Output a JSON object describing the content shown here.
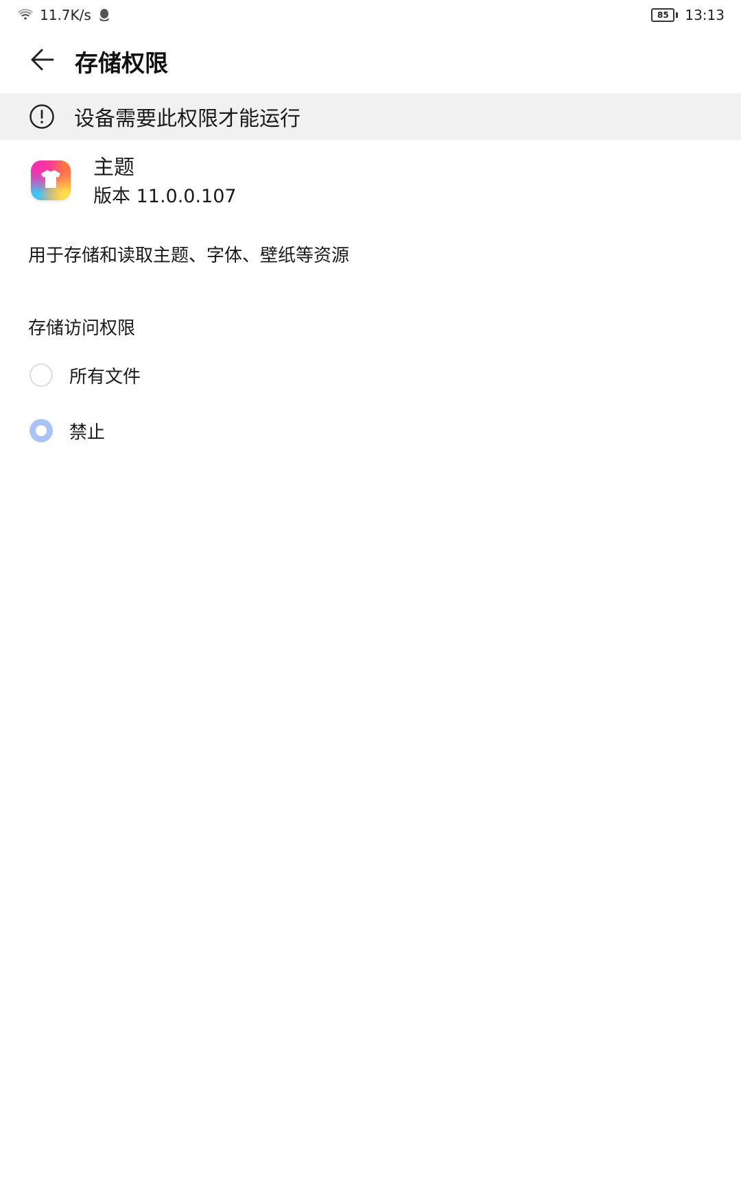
{
  "status_bar": {
    "network_speed": "11.7K/s",
    "battery_level": "85",
    "time": "13:13",
    "icons": [
      "wifi-icon",
      "qq-icon",
      "battery-icon"
    ]
  },
  "header": {
    "title": "存储权限",
    "back_icon": "arrow-left-icon"
  },
  "warning": {
    "icon": "exclamation-circle-icon",
    "text": "设备需要此权限才能运行"
  },
  "app": {
    "name": "主题",
    "version": "版本 11.0.0.107",
    "icon": "t-shirt-icon"
  },
  "description": "用于存储和读取主题、字体、壁纸等资源",
  "permission": {
    "section_title": "存储访问权限",
    "options": [
      {
        "label": "所有文件",
        "selected": false
      },
      {
        "label": "禁止",
        "selected": true
      }
    ]
  },
  "colors": {
    "banner_bg": "#f1f1f1",
    "radio_selected": "#aac3f5"
  }
}
